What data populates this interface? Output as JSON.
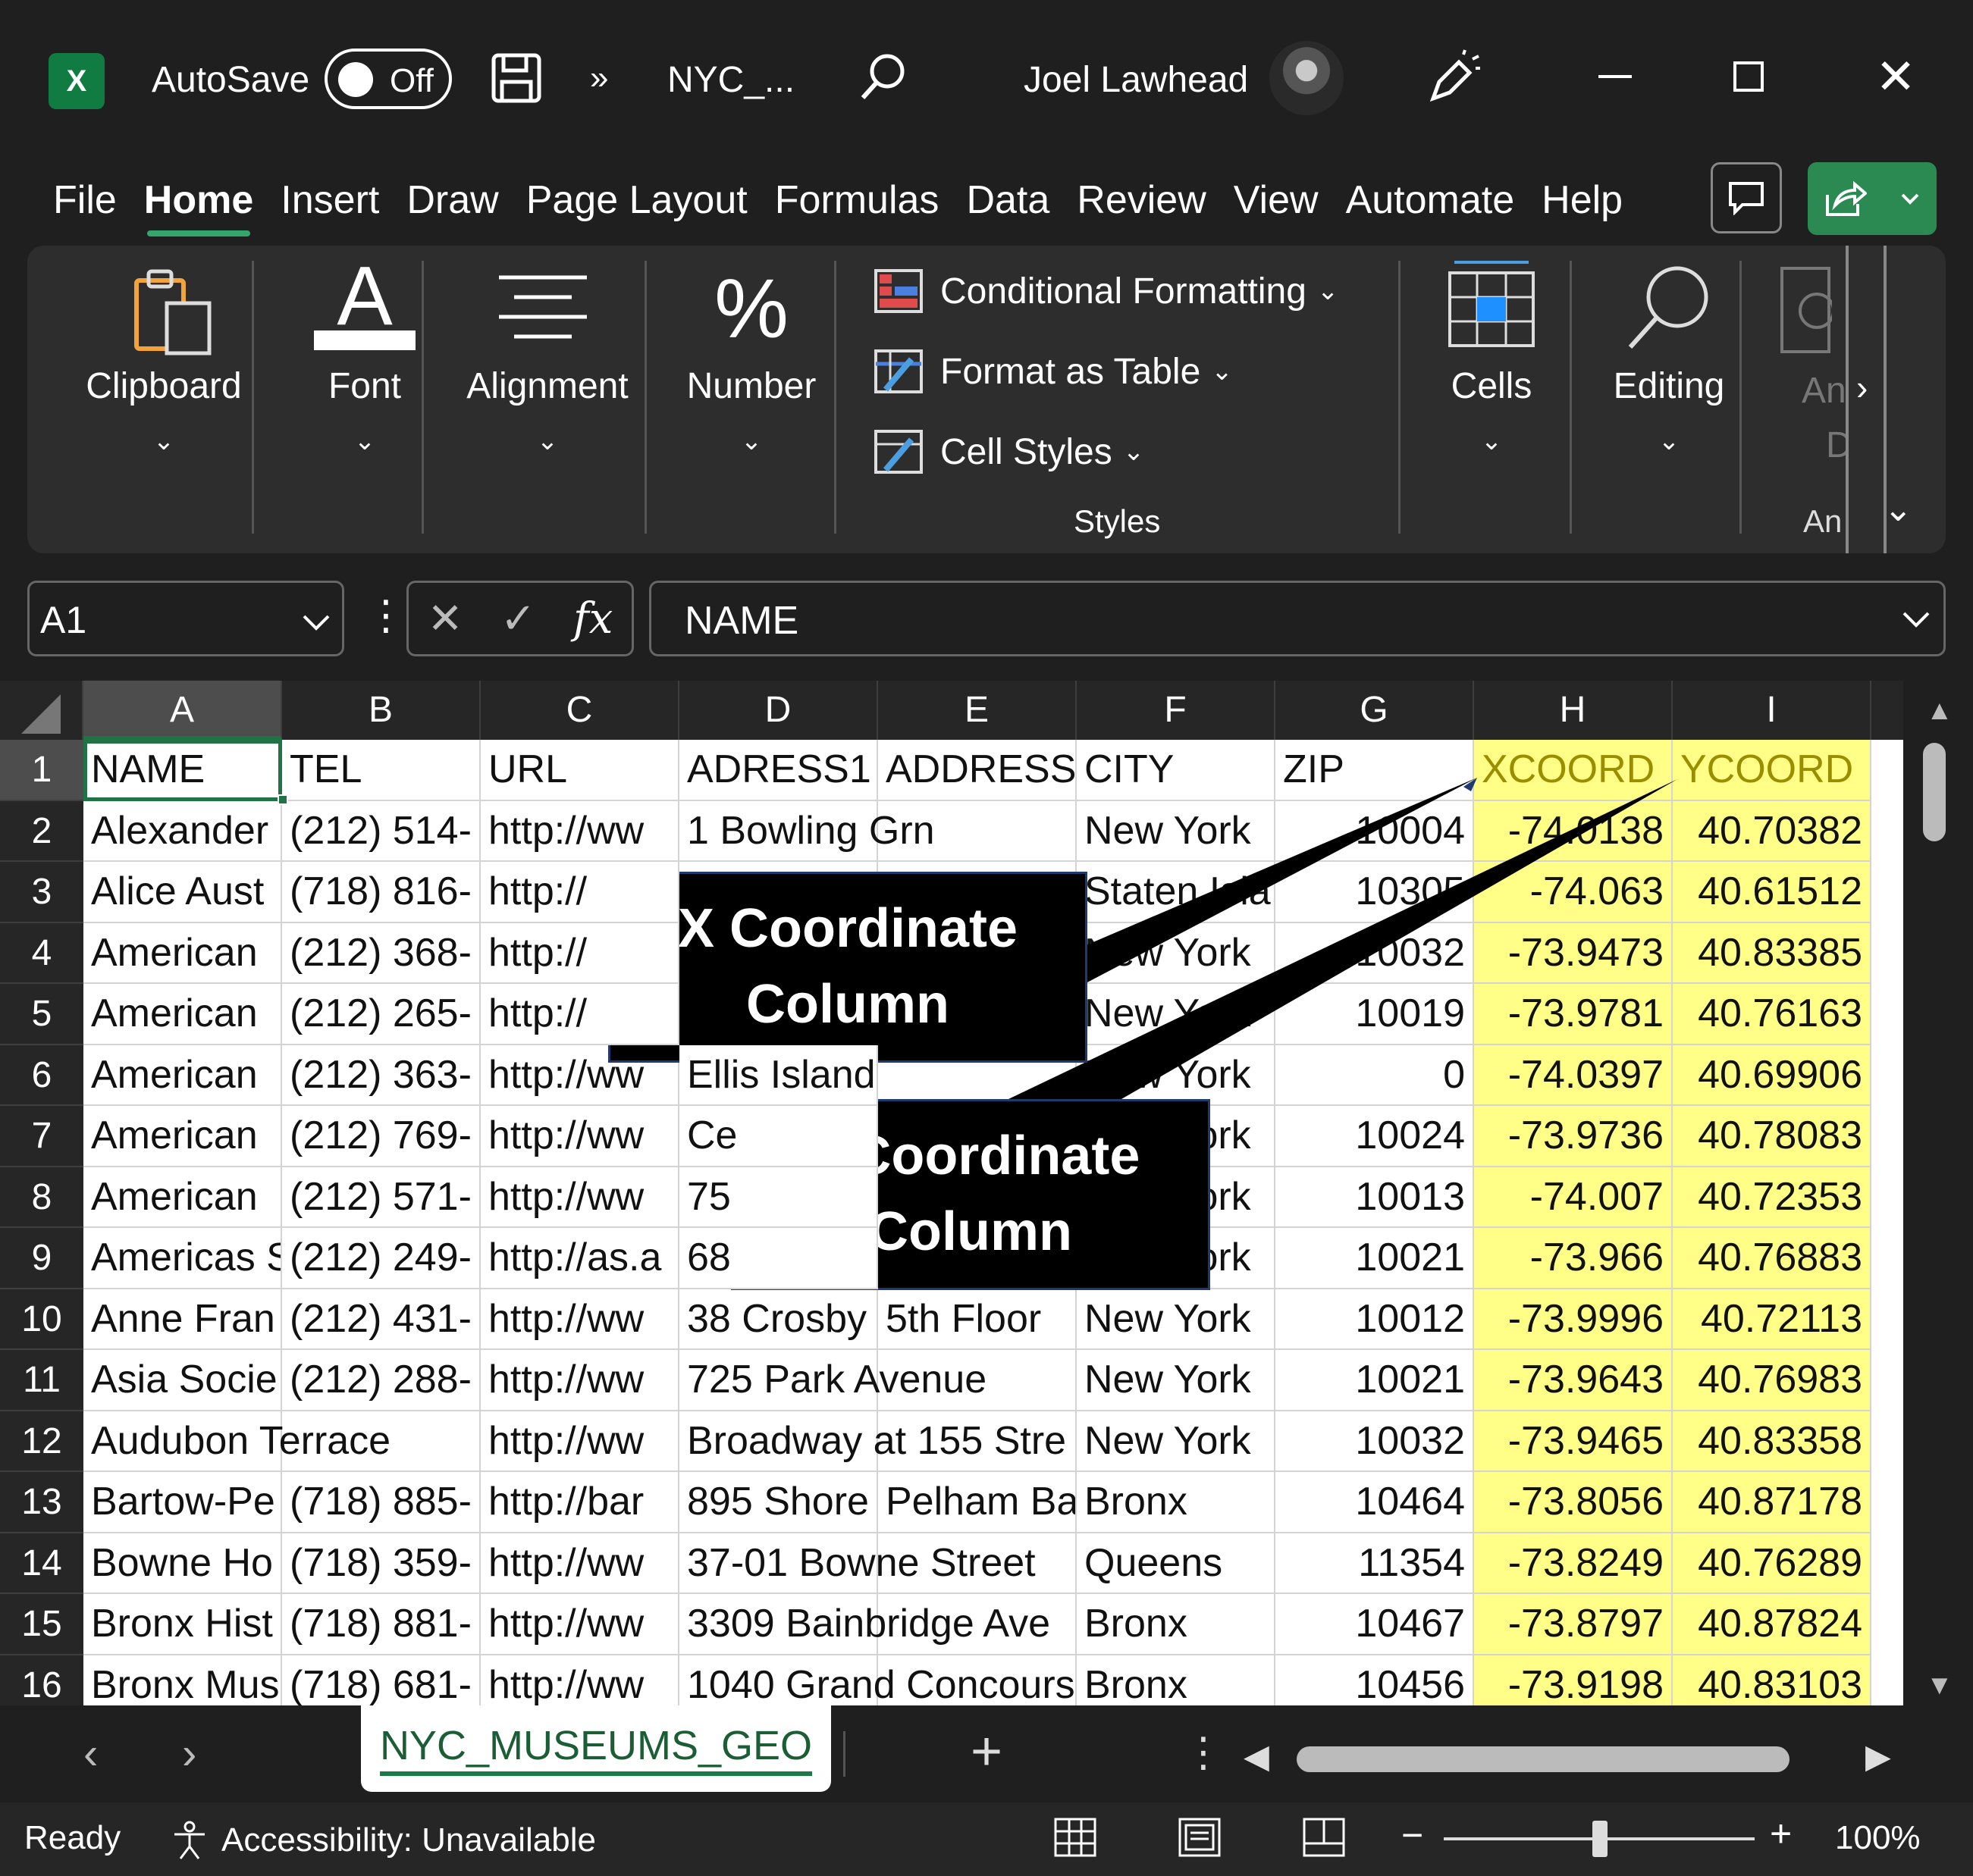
{
  "titlebar": {
    "app_icon": "excel-icon",
    "app_icon_letter": "X",
    "autosave_label": "AutoSave",
    "autosave_state": "Off",
    "more_commands": "»",
    "document_title": "NYC_...",
    "user_name": "Joel Lawhead",
    "close_glyph": "✕"
  },
  "menu": {
    "tabs": [
      "File",
      "Home",
      "Insert",
      "Draw",
      "Page Layout",
      "Formulas",
      "Data",
      "Review",
      "View",
      "Automate",
      "Help"
    ],
    "active_tab": "Home"
  },
  "ribbon": {
    "clipboard": "Clipboard",
    "font": "Font",
    "alignment": "Alignment",
    "number": "Number",
    "number_icon": "%",
    "conditional_formatting": "Conditional Formatting",
    "format_as_table": "Format as Table",
    "cell_styles": "Cell Styles",
    "styles_group": "Styles",
    "cells": "Cells",
    "editing": "Editing",
    "analyze_partial": "An",
    "analyze_partial2": "D",
    "analyze_group_partial": "An",
    "chevron": "⌄",
    "expand_glyph": "⌄"
  },
  "formula_bar": {
    "name_box": "A1",
    "cancel_glyph": "✕",
    "enter_glyph": "✓",
    "fx_label": "fx",
    "formula": "NAME",
    "dots": "⋮"
  },
  "sheet": {
    "columns": [
      "A",
      "B",
      "C",
      "D",
      "E",
      "F",
      "G",
      "H",
      "I"
    ],
    "rows": [
      {
        "n": "1",
        "cells": [
          "NAME",
          "TEL",
          "URL",
          "ADRESS1",
          "ADDRESS2",
          "CITY",
          "ZIP",
          "XCOORD",
          "YCOORD"
        ]
      },
      {
        "n": "2",
        "cells": [
          "Alexander",
          "(212) 514-",
          "http://ww",
          "1 Bowling Grn",
          "",
          "New York",
          "10004",
          "-74.0138",
          "40.70382"
        ]
      },
      {
        "n": "3",
        "cells": [
          "Alice Aust",
          "(718) 816-",
          "http://",
          "",
          "",
          "Staten Isla",
          "10305",
          "-74.063",
          "40.61512"
        ]
      },
      {
        "n": "4",
        "cells": [
          "American",
          "(212) 368-",
          "http://",
          "",
          "",
          "New York",
          "10032",
          "-73.9473",
          "40.83385"
        ]
      },
      {
        "n": "5",
        "cells": [
          "American",
          "(212) 265-",
          "http://",
          "",
          "",
          "New York",
          "10019",
          "-73.9781",
          "40.76163"
        ]
      },
      {
        "n": "6",
        "cells": [
          "American",
          "(212) 363-",
          "http://ww",
          "Ellis Island",
          "",
          "New York",
          "0",
          "-74.0397",
          "40.69906"
        ]
      },
      {
        "n": "7",
        "cells": [
          "American",
          "(212) 769-",
          "http://ww",
          "Ce",
          "",
          "New York",
          "10024",
          "-73.9736",
          "40.78083"
        ]
      },
      {
        "n": "8",
        "cells": [
          "American",
          "(212) 571-",
          "http://ww",
          "75",
          "",
          "New York",
          "10013",
          "-74.007",
          "40.72353"
        ]
      },
      {
        "n": "9",
        "cells": [
          "Americas S",
          "(212) 249-",
          "http://as.a",
          "68",
          "",
          "New York",
          "10021",
          "-73.966",
          "40.76883"
        ]
      },
      {
        "n": "10",
        "cells": [
          "Anne Fran",
          "(212) 431-",
          "http://ww",
          "38 Crosby",
          "5th Floor",
          "New York",
          "10012",
          "-73.9996",
          "40.72113"
        ]
      },
      {
        "n": "11",
        "cells": [
          "Asia Socie",
          "(212) 288-",
          "http://ww",
          "725 Park Avenue",
          "",
          "New York",
          "10021",
          "-73.9643",
          "40.76983"
        ]
      },
      {
        "n": "12",
        "cells": [
          "Audubon Terrace",
          "",
          "http://ww",
          "Broadway at 155 Stre",
          "",
          "New York",
          "10032",
          "-73.9465",
          "40.83358"
        ]
      },
      {
        "n": "13",
        "cells": [
          "Bartow-Pe",
          "(718) 885-",
          "http://bar",
          "895 Shore",
          "Pelham Ba",
          "Bronx",
          "10464",
          "-73.8056",
          "40.87178"
        ]
      },
      {
        "n": "14",
        "cells": [
          "Bowne Ho",
          "(718) 359-",
          "http://ww",
          "37-01 Bowne Street",
          "",
          "Queens",
          "11354",
          "-73.8249",
          "40.76289"
        ]
      },
      {
        "n": "15",
        "cells": [
          "Bronx Hist",
          "(718) 881-",
          "http://ww",
          "3309 Bainbridge Ave",
          "",
          "Bronx",
          "10467",
          "-73.8797",
          "40.87824"
        ]
      },
      {
        "n": "16",
        "cells": [
          "Bronx Mus",
          "(718) 681-",
          "http://ww",
          "1040 Grand Concours",
          "",
          "Bronx",
          "10456",
          "-73.9198",
          "40.83103"
        ]
      }
    ],
    "highlight_color": "#ffff88"
  },
  "callouts": {
    "x_line1": "X Coordinate",
    "x_line2": "Column",
    "y_line1": "Y Coordinate",
    "y_line2": "Column"
  },
  "sheet_tabs": {
    "prev": "‹",
    "next": "›",
    "active": "NYC_MUSEUMS_GEO",
    "add": "+",
    "more": "⋮"
  },
  "status": {
    "ready": "Ready",
    "accessibility": "Accessibility: Unavailable",
    "zoom_minus": "−",
    "zoom_plus": "+",
    "zoom": "100%"
  },
  "colors": {
    "accent_green": "#217346",
    "share_green": "#2a8a52",
    "highlight": "#ffff88"
  }
}
